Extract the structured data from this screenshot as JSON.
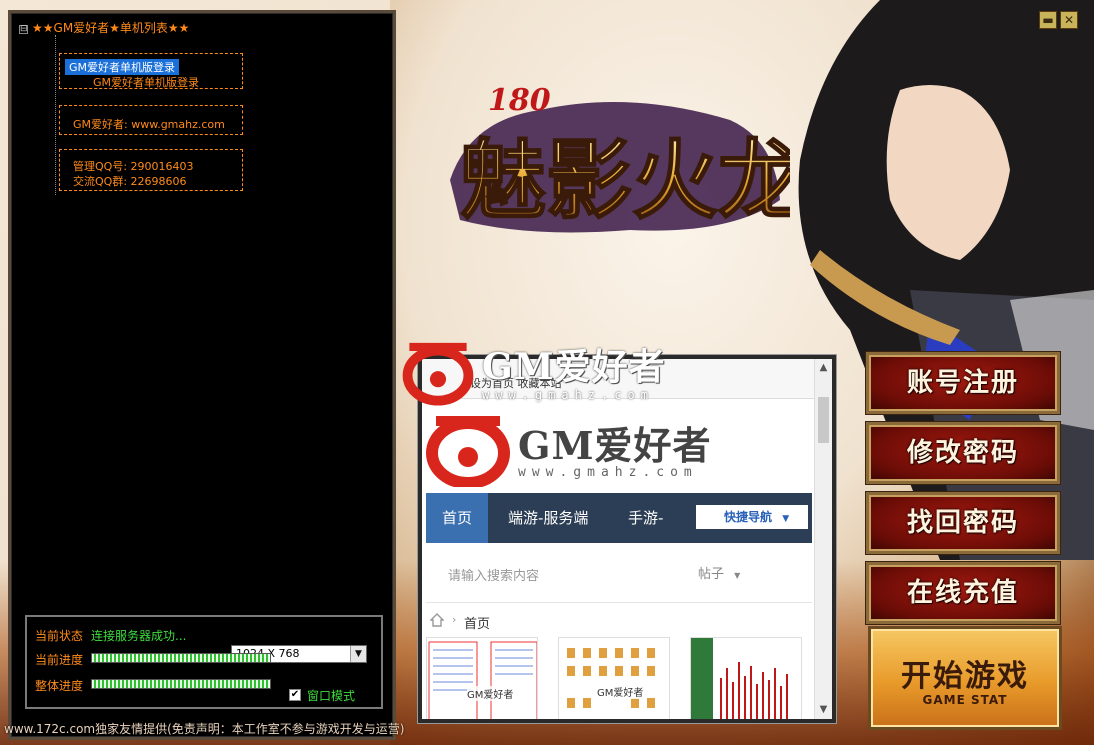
{
  "window": {
    "minimize_icon": "minimize-icon",
    "close_icon": "close-icon",
    "minimize_glyph": "▬",
    "close_glyph": "✕"
  },
  "server_tree": {
    "root_label": "★★GM爱好者★单机列表★★",
    "toggle_glyph": "⊟",
    "items": [
      {
        "label": "GM爱好者单机版登录",
        "selected": true
      },
      {
        "label": "GM爱好者单机版登录",
        "selected": false
      },
      {
        "label": "GM爱好者: www.gmahz.com",
        "selected": false
      },
      {
        "label": "管理QQ号: 290016403",
        "selected": false
      },
      {
        "label": "交流QQ群: 22698606",
        "selected": false
      }
    ]
  },
  "status_panel": {
    "state_label": "当前状态",
    "state_value": "连接服务器成功...",
    "progress_label": "当前进度",
    "overall_label": "整体进度",
    "progress_value": 1.0,
    "overall_value": 1.0,
    "resolution": "1024 X 768",
    "dropdown_glyph": "▼",
    "window_mode_label": "窗口模式",
    "window_mode_checked": true,
    "check_glyph": "✔"
  },
  "footer_watermark": "www.172c.com独家友情提供(免责声明：本工作室不参与游戏开发与运营)",
  "game_logo": {
    "number": "180",
    "title": "魅影火龙"
  },
  "browser": {
    "top_text": "设为首页 收藏本站",
    "site_name": "GM爱好者",
    "site_url": "www.gmahz.com",
    "nav": [
      "首页",
      "端游-服务端",
      "手游-"
    ],
    "quick_nav": "快捷导航",
    "search_placeholder": "请输入搜索内容",
    "search_type": "帖子",
    "breadcrumb": "首页",
    "thumb_logo": "GM爱好者",
    "scroll_up_glyph": "▲",
    "scroll_down_glyph": "▼",
    "crumb_sep_glyph": "›",
    "dropdown_glyph": "▼"
  },
  "overlay_watermark": {
    "name": "GM爱好者",
    "url": "www.gmahz.com"
  },
  "actions": {
    "register": "账号注册",
    "change_password": "修改密码",
    "recover_password": "找回密码",
    "recharge": "在线充值",
    "start_title": "开始游戏",
    "start_sub": "GAME STAT"
  },
  "colors": {
    "tree_text": "#ff8a1a",
    "status_text": "#3fdc3f",
    "button_red": "#a41a10",
    "start_gold": "#e89a2a",
    "nav_bg": "#2c3e55",
    "site_red": "#d9261c"
  }
}
